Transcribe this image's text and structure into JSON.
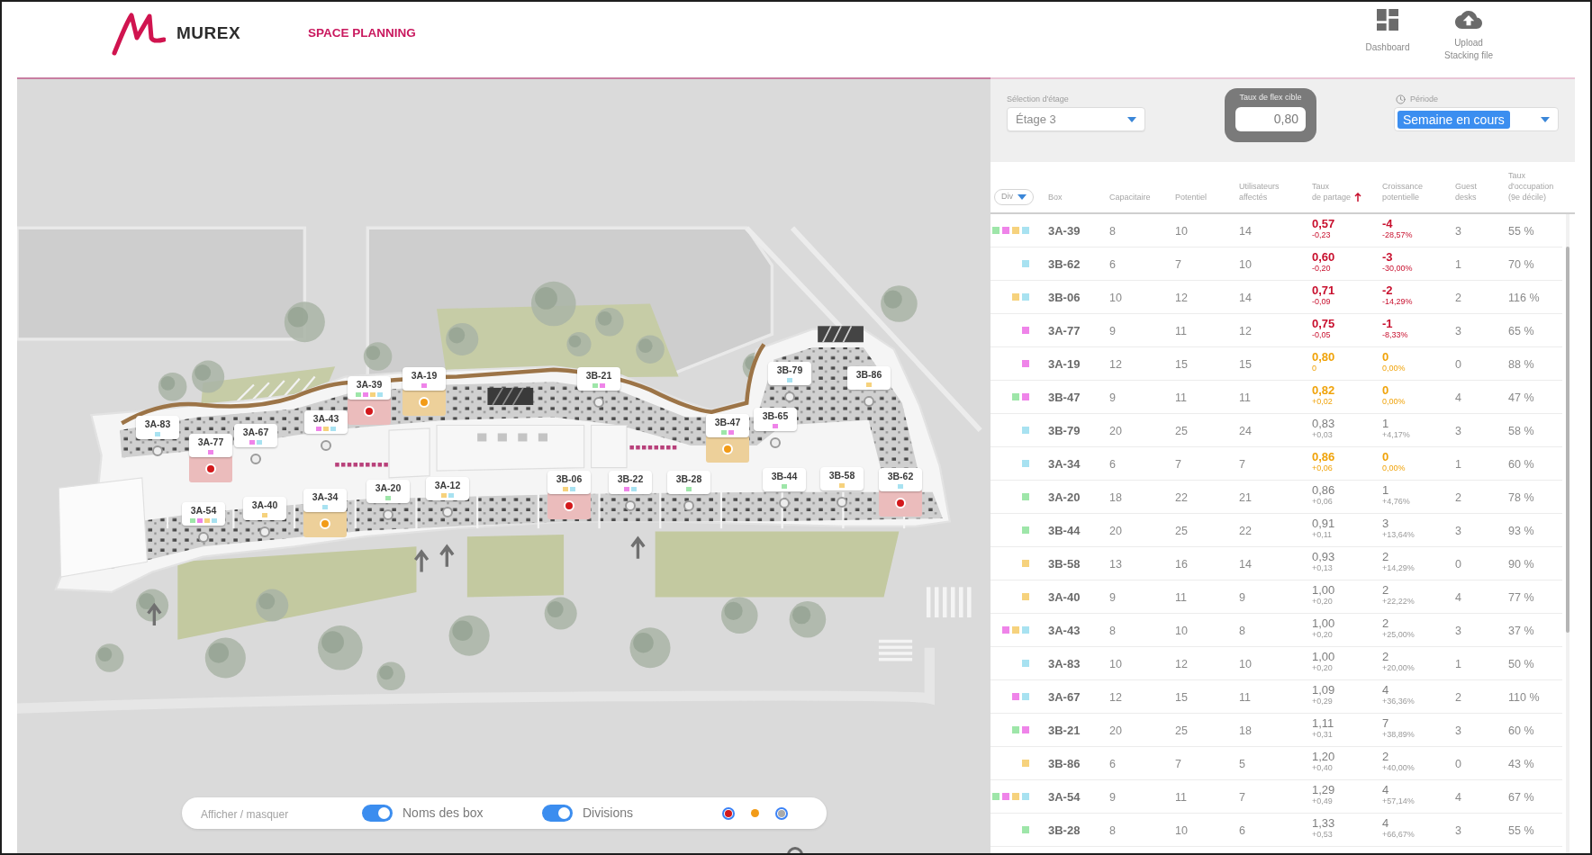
{
  "header": {
    "logo_text": "MUREX",
    "app_title": "SPACE PLANNING",
    "nav": [
      {
        "kind": "dashboard",
        "label": "Dashboard"
      },
      {
        "kind": "upload",
        "label": "Upload\nStacking file"
      }
    ]
  },
  "map": {
    "pins": [
      {
        "name": "3A-83",
        "kind": "normal",
        "divisions": [
          {
            "color": "#a8e2f1"
          }
        ]
      },
      {
        "name": "3A-77",
        "kind": "critical",
        "divisions": [
          {
            "color": "#ef84e9"
          }
        ]
      },
      {
        "name": "3A-67",
        "kind": "normal",
        "divisions": [
          {
            "color": "#ef84e9"
          },
          {
            "color": "#a8e2f1"
          }
        ]
      },
      {
        "name": "3A-43",
        "kind": "normal",
        "divisions": [
          {
            "color": "#ef84e9"
          },
          {
            "color": "#f6d27d"
          },
          {
            "color": "#a8e2f1"
          }
        ]
      },
      {
        "name": "3A-39",
        "kind": "critical",
        "divisions": [
          {
            "color": "#9ee6a9"
          },
          {
            "color": "#ef84e9"
          },
          {
            "color": "#f6d27d"
          },
          {
            "color": "#a8e2f1"
          }
        ]
      },
      {
        "name": "3A-19",
        "kind": "warning",
        "divisions": [
          {
            "color": "#ef84e9"
          }
        ]
      },
      {
        "name": "3B-21",
        "kind": "normal",
        "divisions": [
          {
            "color": "#9ee6a9"
          },
          {
            "color": "#ef84e9"
          }
        ]
      },
      {
        "name": "3B-47",
        "kind": "warning",
        "divisions": [
          {
            "color": "#9ee6a9"
          },
          {
            "color": "#ef84e9"
          }
        ]
      },
      {
        "name": "3B-65",
        "kind": "normal",
        "divisions": [
          {
            "color": "#ef84e9"
          }
        ]
      },
      {
        "name": "3B-79",
        "kind": "normal",
        "divisions": [
          {
            "color": "#a8e2f1"
          }
        ]
      },
      {
        "name": "3B-86",
        "kind": "normal",
        "divisions": [
          {
            "color": "#f6d27d"
          }
        ]
      },
      {
        "name": "3A-54",
        "kind": "normal",
        "divisions": [
          {
            "color": "#9ee6a9"
          },
          {
            "color": "#ef84e9"
          },
          {
            "color": "#f6d27d"
          },
          {
            "color": "#a8e2f1"
          }
        ]
      },
      {
        "name": "3A-40",
        "kind": "normal",
        "divisions": [
          {
            "color": "#f6d27d"
          }
        ]
      },
      {
        "name": "3A-34",
        "kind": "warning",
        "divisions": [
          {
            "color": "#a8e2f1"
          }
        ]
      },
      {
        "name": "3A-20",
        "kind": "normal",
        "divisions": [
          {
            "color": "#9ee6a9"
          }
        ]
      },
      {
        "name": "3A-12",
        "kind": "normal",
        "divisions": [
          {
            "color": "#f6d27d"
          },
          {
            "color": "#a8e2f1"
          }
        ]
      },
      {
        "name": "3B-06",
        "kind": "critical",
        "divisions": [
          {
            "color": "#f6d27d"
          },
          {
            "color": "#a8e2f1"
          }
        ]
      },
      {
        "name": "3B-22",
        "kind": "normal",
        "divisions": [
          {
            "color": "#ef84e9"
          },
          {
            "color": "#a8e2f1"
          }
        ]
      },
      {
        "name": "3B-28",
        "kind": "normal",
        "divisions": [
          {
            "color": "#9ee6a9"
          }
        ]
      },
      {
        "name": "3B-44",
        "kind": "normal",
        "divisions": [
          {
            "color": "#9ee6a9"
          }
        ]
      },
      {
        "name": "3B-58",
        "kind": "normal",
        "divisions": [
          {
            "color": "#f6d27d"
          }
        ]
      },
      {
        "name": "3B-62",
        "kind": "critical",
        "divisions": [
          {
            "color": "#a8e2f1"
          }
        ]
      }
    ],
    "display_bar": {
      "label": "Afficher / masquer",
      "toggles": [
        {
          "label": "Noms des box",
          "on": true
        },
        {
          "label": "Divisions",
          "on": true
        }
      ],
      "legend": [
        {
          "color": "#d3191c",
          "selected": true
        },
        {
          "color": "#f29b17",
          "selected": false
        },
        {
          "color": "#a9a9a9",
          "selected": true
        }
      ]
    }
  },
  "panel": {
    "floor_select": {
      "label": "Sélection d'étage",
      "value": "Étage 3"
    },
    "flex_target": {
      "label": "Taux de flex cible",
      "value": "0,80"
    },
    "period_select": {
      "label": "Période",
      "value": "Semaine en cours",
      "focused": true
    },
    "table": {
      "div_filter": {
        "label": "Div"
      },
      "columns": [
        {
          "label": "Box",
          "sorted": false
        },
        {
          "label": "Capacitaire",
          "sorted": false
        },
        {
          "label": "Potentiel",
          "sorted": false
        },
        {
          "label": "Utilisateurs\naffectés",
          "sorted": false
        },
        {
          "label": "Taux\nde partage",
          "sorted": true
        },
        {
          "label": "Croissance\npotentielle",
          "sorted": false
        },
        {
          "label": "Guest\ndesks",
          "sorted": false
        },
        {
          "label": "Taux\nd'occupation\n(9e décile)",
          "sorted": false
        }
      ],
      "rows": [
        {
          "divisions": [
            {
              "color": "#9ee6a9"
            },
            {
              "color": "#ef84e9"
            },
            {
              "color": "#f6d27d"
            },
            {
              "color": "#a8e2f1"
            }
          ],
          "box": "3A-39",
          "capacitaire": "8",
          "potentiel": "10",
          "utilisateurs": "14",
          "taux": "0,57",
          "taux_delta": "-0,23",
          "croissance": "-4",
          "croissance_pct": "-28,57%",
          "guest_desks": "3",
          "occupation": "55 %",
          "kind": "critical"
        },
        {
          "divisions": [
            {
              "color": "#a8e2f1"
            }
          ],
          "box": "3B-62",
          "capacitaire": "6",
          "potentiel": "7",
          "utilisateurs": "10",
          "taux": "0,60",
          "taux_delta": "-0,20",
          "croissance": "-3",
          "croissance_pct": "-30,00%",
          "guest_desks": "1",
          "occupation": "70 %",
          "kind": "critical"
        },
        {
          "divisions": [
            {
              "color": "#f6d27d"
            },
            {
              "color": "#a8e2f1"
            }
          ],
          "box": "3B-06",
          "capacitaire": "10",
          "potentiel": "12",
          "utilisateurs": "14",
          "taux": "0,71",
          "taux_delta": "-0,09",
          "croissance": "-2",
          "croissance_pct": "-14,29%",
          "guest_desks": "2",
          "occupation": "116 %",
          "kind": "critical"
        },
        {
          "divisions": [
            {
              "color": "#ef84e9"
            }
          ],
          "box": "3A-77",
          "capacitaire": "9",
          "potentiel": "11",
          "utilisateurs": "12",
          "taux": "0,75",
          "taux_delta": "-0,05",
          "croissance": "-1",
          "croissance_pct": "-8,33%",
          "guest_desks": "3",
          "occupation": "65 %",
          "kind": "critical"
        },
        {
          "divisions": [
            {
              "color": "#ef84e9"
            }
          ],
          "box": "3A-19",
          "capacitaire": "12",
          "potentiel": "15",
          "utilisateurs": "15",
          "taux": "0,80",
          "taux_delta": "0",
          "croissance": "0",
          "croissance_pct": "0,00%",
          "guest_desks": "0",
          "occupation": "88 %",
          "kind": "warning"
        },
        {
          "divisions": [
            {
              "color": "#9ee6a9"
            },
            {
              "color": "#ef84e9"
            }
          ],
          "box": "3B-47",
          "capacitaire": "9",
          "potentiel": "11",
          "utilisateurs": "11",
          "taux": "0,82",
          "taux_delta": "+0,02",
          "croissance": "0",
          "croissance_pct": "0,00%",
          "guest_desks": "4",
          "occupation": "47 %",
          "kind": "warning"
        },
        {
          "divisions": [
            {
              "color": "#a8e2f1"
            }
          ],
          "box": "3B-79",
          "capacitaire": "20",
          "potentiel": "25",
          "utilisateurs": "24",
          "taux": "0,83",
          "taux_delta": "+0,03",
          "croissance": "1",
          "croissance_pct": "+4,17%",
          "guest_desks": "3",
          "occupation": "58 %",
          "kind": "normal"
        },
        {
          "divisions": [
            {
              "color": "#a8e2f1"
            }
          ],
          "box": "3A-34",
          "capacitaire": "6",
          "potentiel": "7",
          "utilisateurs": "7",
          "taux": "0,86",
          "taux_delta": "+0,06",
          "croissance": "0",
          "croissance_pct": "0,00%",
          "guest_desks": "1",
          "occupation": "60 %",
          "kind": "warning"
        },
        {
          "divisions": [
            {
              "color": "#9ee6a9"
            }
          ],
          "box": "3A-20",
          "capacitaire": "18",
          "potentiel": "22",
          "utilisateurs": "21",
          "taux": "0,86",
          "taux_delta": "+0,06",
          "croissance": "1",
          "croissance_pct": "+4,76%",
          "guest_desks": "2",
          "occupation": "78 %",
          "kind": "normal"
        },
        {
          "divisions": [
            {
              "color": "#9ee6a9"
            }
          ],
          "box": "3B-44",
          "capacitaire": "20",
          "potentiel": "25",
          "utilisateurs": "22",
          "taux": "0,91",
          "taux_delta": "+0,11",
          "croissance": "3",
          "croissance_pct": "+13,64%",
          "guest_desks": "3",
          "occupation": "93 %",
          "kind": "normal"
        },
        {
          "divisions": [
            {
              "color": "#f6d27d"
            }
          ],
          "box": "3B-58",
          "capacitaire": "13",
          "potentiel": "16",
          "utilisateurs": "14",
          "taux": "0,93",
          "taux_delta": "+0,13",
          "croissance": "2",
          "croissance_pct": "+14,29%",
          "guest_desks": "0",
          "occupation": "90 %",
          "kind": "normal"
        },
        {
          "divisions": [
            {
              "color": "#f6d27d"
            }
          ],
          "box": "3A-40",
          "capacitaire": "9",
          "potentiel": "11",
          "utilisateurs": "9",
          "taux": "1,00",
          "taux_delta": "+0,20",
          "croissance": "2",
          "croissance_pct": "+22,22%",
          "guest_desks": "4",
          "occupation": "77 %",
          "kind": "normal"
        },
        {
          "divisions": [
            {
              "color": "#ef84e9"
            },
            {
              "color": "#f6d27d"
            },
            {
              "color": "#a8e2f1"
            }
          ],
          "box": "3A-43",
          "capacitaire": "8",
          "potentiel": "10",
          "utilisateurs": "8",
          "taux": "1,00",
          "taux_delta": "+0,20",
          "croissance": "2",
          "croissance_pct": "+25,00%",
          "guest_desks": "3",
          "occupation": "37 %",
          "kind": "normal"
        },
        {
          "divisions": [
            {
              "color": "#a8e2f1"
            }
          ],
          "box": "3A-83",
          "capacitaire": "10",
          "potentiel": "12",
          "utilisateurs": "10",
          "taux": "1,00",
          "taux_delta": "+0,20",
          "croissance": "2",
          "croissance_pct": "+20,00%",
          "guest_desks": "1",
          "occupation": "50 %",
          "kind": "normal"
        },
        {
          "divisions": [
            {
              "color": "#ef84e9"
            },
            {
              "color": "#a8e2f1"
            }
          ],
          "box": "3A-67",
          "capacitaire": "12",
          "potentiel": "15",
          "utilisateurs": "11",
          "taux": "1,09",
          "taux_delta": "+0,29",
          "croissance": "4",
          "croissance_pct": "+36,36%",
          "guest_desks": "2",
          "occupation": "110 %",
          "kind": "normal"
        },
        {
          "divisions": [
            {
              "color": "#9ee6a9"
            },
            {
              "color": "#ef84e9"
            }
          ],
          "box": "3B-21",
          "capacitaire": "20",
          "potentiel": "25",
          "utilisateurs": "18",
          "taux": "1,11",
          "taux_delta": "+0,31",
          "croissance": "7",
          "croissance_pct": "+38,89%",
          "guest_desks": "3",
          "occupation": "60 %",
          "kind": "normal"
        },
        {
          "divisions": [
            {
              "color": "#f6d27d"
            }
          ],
          "box": "3B-86",
          "capacitaire": "6",
          "potentiel": "7",
          "utilisateurs": "5",
          "taux": "1,20",
          "taux_delta": "+0,40",
          "croissance": "2",
          "croissance_pct": "+40,00%",
          "guest_desks": "0",
          "occupation": "43 %",
          "kind": "normal"
        },
        {
          "divisions": [
            {
              "color": "#9ee6a9"
            },
            {
              "color": "#ef84e9"
            },
            {
              "color": "#f6d27d"
            },
            {
              "color": "#a8e2f1"
            }
          ],
          "box": "3A-54",
          "capacitaire": "9",
          "potentiel": "11",
          "utilisateurs": "7",
          "taux": "1,29",
          "taux_delta": "+0,49",
          "croissance": "4",
          "croissance_pct": "+57,14%",
          "guest_desks": "4",
          "occupation": "67 %",
          "kind": "normal"
        },
        {
          "divisions": [
            {
              "color": "#9ee6a9"
            }
          ],
          "box": "3B-28",
          "capacitaire": "8",
          "potentiel": "10",
          "utilisateurs": "6",
          "taux": "1,33",
          "taux_delta": "+0,53",
          "croissance": "4",
          "croissance_pct": "+66,67%",
          "guest_desks": "3",
          "occupation": "55 %",
          "kind": "normal"
        }
      ]
    }
  }
}
